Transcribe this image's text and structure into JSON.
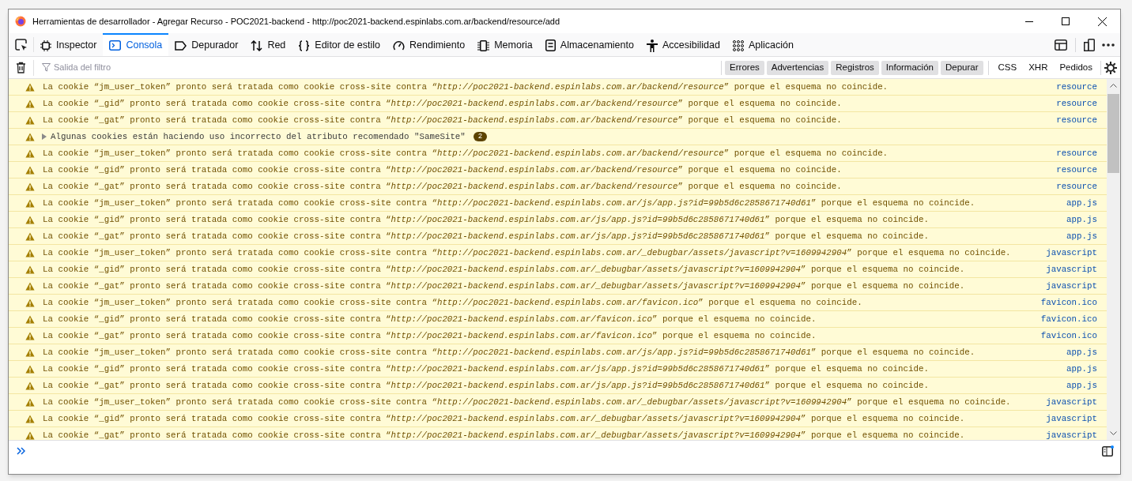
{
  "window": {
    "title": "Herramientas de desarrollador - Agregar Recurso - POC2021-backend - http://poc2021-backend.espinlabs.com.ar/backend/resource/add"
  },
  "tabs": [
    {
      "label": "Inspector",
      "selected": false
    },
    {
      "label": "Consola",
      "selected": true
    },
    {
      "label": "Depurador",
      "selected": false
    },
    {
      "label": "Red",
      "selected": false
    },
    {
      "label": "Editor de estilo",
      "selected": false
    },
    {
      "label": "Rendimiento",
      "selected": false
    },
    {
      "label": "Memoria",
      "selected": false
    },
    {
      "label": "Almacenamiento",
      "selected": false
    },
    {
      "label": "Accesibilidad",
      "selected": false
    },
    {
      "label": "Aplicación",
      "selected": false
    }
  ],
  "filter": {
    "placeholder": "Salida del filtro"
  },
  "levels": [
    {
      "label": "Errores",
      "selected": true
    },
    {
      "label": "Advertencias",
      "selected": true
    },
    {
      "label": "Registros",
      "selected": true
    },
    {
      "label": "Información",
      "selected": true
    },
    {
      "label": "Depurar",
      "selected": true
    }
  ],
  "requests": [
    {
      "label": "CSS",
      "selected": false
    },
    {
      "label": "XHR",
      "selected": false
    },
    {
      "label": "Pedidos",
      "selected": false
    }
  ],
  "messages": [
    {
      "kind": "warning",
      "text": "La cookie “jm_user_token” pronto será tratada como cookie cross-site contra “*http://poc2021-backend.espinlabs.com.ar/backend/resource*” porque el esquema no coincide.",
      "source": "resource"
    },
    {
      "kind": "warning",
      "text": "La cookie “_gid” pronto será tratada como cookie cross-site contra “*http://poc2021-backend.espinlabs.com.ar/backend/resource*” porque el esquema no coincide.",
      "source": "resource"
    },
    {
      "kind": "warning",
      "text": "La cookie “_gat” pronto será tratada como cookie cross-site contra “*http://poc2021-backend.espinlabs.com.ar/backend/resource*” porque el esquema no coincide.",
      "source": "resource"
    },
    {
      "kind": "group",
      "text": "Algunas cookies están haciendo uso incorrecto del atributo recomendado \"SameSite\"",
      "count": "2",
      "expanded": false
    },
    {
      "kind": "warning",
      "text": "La cookie “jm_user_token” pronto será tratada como cookie cross-site contra “*http://poc2021-backend.espinlabs.com.ar/backend/resource*” porque el esquema no coincide.",
      "source": "resource"
    },
    {
      "kind": "warning",
      "text": "La cookie “_gid” pronto será tratada como cookie cross-site contra “*http://poc2021-backend.espinlabs.com.ar/backend/resource*” porque el esquema no coincide.",
      "source": "resource"
    },
    {
      "kind": "warning",
      "text": "La cookie “_gat” pronto será tratada como cookie cross-site contra “*http://poc2021-backend.espinlabs.com.ar/backend/resource*” porque el esquema no coincide.",
      "source": "resource"
    },
    {
      "kind": "warning",
      "text": "La cookie “jm_user_token” pronto será tratada como cookie cross-site contra “*http://poc2021-backend.espinlabs.com.ar/js/app.js?id=99b5d6c2858671740d61*” porque el esquema no coincide.",
      "source": "app.js"
    },
    {
      "kind": "warning",
      "text": "La cookie “_gid” pronto será tratada como cookie cross-site contra “*http://poc2021-backend.espinlabs.com.ar/js/app.js?id=99b5d6c2858671740d61*” porque el esquema no coincide.",
      "source": "app.js"
    },
    {
      "kind": "warning",
      "text": "La cookie “_gat” pronto será tratada como cookie cross-site contra “*http://poc2021-backend.espinlabs.com.ar/js/app.js?id=99b5d6c2858671740d61*” porque el esquema no coincide.",
      "source": "app.js"
    },
    {
      "kind": "warning",
      "text": "La cookie “jm_user_token” pronto será tratada como cookie cross-site contra “*http://poc2021-backend.espinlabs.com.ar/_debugbar/assets/javascript?v=1609942904*” porque el esquema no coincide.",
      "source": "javascript"
    },
    {
      "kind": "warning",
      "text": "La cookie “_gid” pronto será tratada como cookie cross-site contra “*http://poc2021-backend.espinlabs.com.ar/_debugbar/assets/javascript?v=1609942904*” porque el esquema no coincide.",
      "source": "javascript"
    },
    {
      "kind": "warning",
      "text": "La cookie “_gat” pronto será tratada como cookie cross-site contra “*http://poc2021-backend.espinlabs.com.ar/_debugbar/assets/javascript?v=1609942904*” porque el esquema no coincide.",
      "source": "javascript"
    },
    {
      "kind": "warning",
      "text": "La cookie “jm_user_token” pronto será tratada como cookie cross-site contra “*http://poc2021-backend.espinlabs.com.ar/favicon.ico*” porque el esquema no coincide.",
      "source": "favicon.ico"
    },
    {
      "kind": "warning",
      "text": "La cookie “_gid” pronto será tratada como cookie cross-site contra “*http://poc2021-backend.espinlabs.com.ar/favicon.ico*” porque el esquema no coincide.",
      "source": "favicon.ico"
    },
    {
      "kind": "warning",
      "text": "La cookie “_gat” pronto será tratada como cookie cross-site contra “*http://poc2021-backend.espinlabs.com.ar/favicon.ico*” porque el esquema no coincide.",
      "source": "favicon.ico"
    },
    {
      "kind": "warning",
      "text": "La cookie “jm_user_token” pronto será tratada como cookie cross-site contra “*http://poc2021-backend.espinlabs.com.ar/js/app.js?id=99b5d6c2858671740d61*” porque el esquema no coincide.",
      "source": "app.js"
    },
    {
      "kind": "warning",
      "text": "La cookie “_gid” pronto será tratada como cookie cross-site contra “*http://poc2021-backend.espinlabs.com.ar/js/app.js?id=99b5d6c2858671740d61*” porque el esquema no coincide.",
      "source": "app.js"
    },
    {
      "kind": "warning",
      "text": "La cookie “_gat” pronto será tratada como cookie cross-site contra “*http://poc2021-backend.espinlabs.com.ar/js/app.js?id=99b5d6c2858671740d61*” porque el esquema no coincide.",
      "source": "app.js"
    },
    {
      "kind": "warning",
      "text": "La cookie “jm_user_token” pronto será tratada como cookie cross-site contra “*http://poc2021-backend.espinlabs.com.ar/_debugbar/assets/javascript?v=1609942904*” porque el esquema no coincide.",
      "source": "javascript"
    },
    {
      "kind": "warning",
      "text": "La cookie “_gid” pronto será tratada como cookie cross-site contra “*http://poc2021-backend.espinlabs.com.ar/_debugbar/assets/javascript?v=1609942904*” porque el esquema no coincide.",
      "source": "javascript"
    },
    {
      "kind": "warning",
      "text": "La cookie “_gat” pronto será tratada como cookie cross-site contra “*http://poc2021-backend.espinlabs.com.ar/_debugbar/assets/javascript?v=1609942904*” porque el esquema no coincide.",
      "source": "javascript"
    }
  ]
}
